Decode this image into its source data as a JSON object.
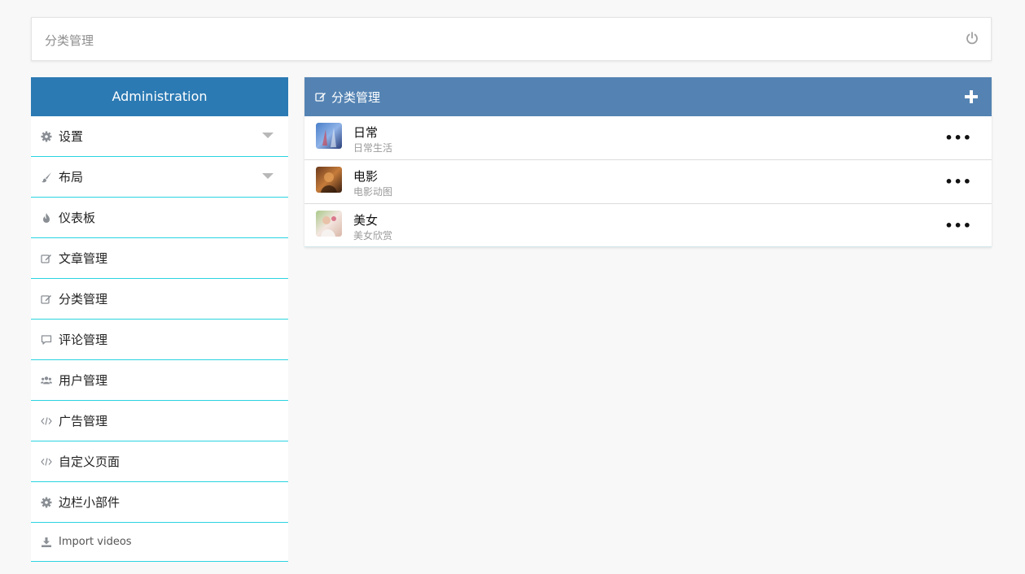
{
  "header": {
    "title": "分类管理",
    "power_icon": "power-icon"
  },
  "sidebar": {
    "title": "Administration",
    "items": [
      {
        "label": "设置",
        "icon": "gear-icon",
        "has_caret": true
      },
      {
        "label": "布局",
        "icon": "brush-icon",
        "has_caret": true
      },
      {
        "label": "仪表板",
        "icon": "fire-icon",
        "has_caret": false
      },
      {
        "label": "文章管理",
        "icon": "edit-icon",
        "has_caret": false
      },
      {
        "label": "分类管理",
        "icon": "edit-icon",
        "has_caret": false
      },
      {
        "label": "评论管理",
        "icon": "comment-icon",
        "has_caret": false
      },
      {
        "label": "用户管理",
        "icon": "users-icon",
        "has_caret": false
      },
      {
        "label": "广告管理",
        "icon": "code-icon",
        "has_caret": false
      },
      {
        "label": "自定义页面",
        "icon": "code-icon",
        "has_caret": false
      },
      {
        "label": "边栏小部件",
        "icon": "gear-icon",
        "has_caret": false
      },
      {
        "label": "Import videos",
        "icon": "download-icon",
        "has_caret": false
      }
    ]
  },
  "panel": {
    "title": "分类管理",
    "add_icon": "plus-icon",
    "categories": [
      {
        "name": "日常",
        "desc": "日常生活",
        "more": "•••"
      },
      {
        "name": "电影",
        "desc": "电影动图",
        "more": "•••"
      },
      {
        "name": "美女",
        "desc": "美女欣赏",
        "more": "•••"
      }
    ]
  },
  "colors": {
    "sidebar_header": "#2b7ab3",
    "panel_header": "#5483b3",
    "divider": "#2ad4e0"
  }
}
